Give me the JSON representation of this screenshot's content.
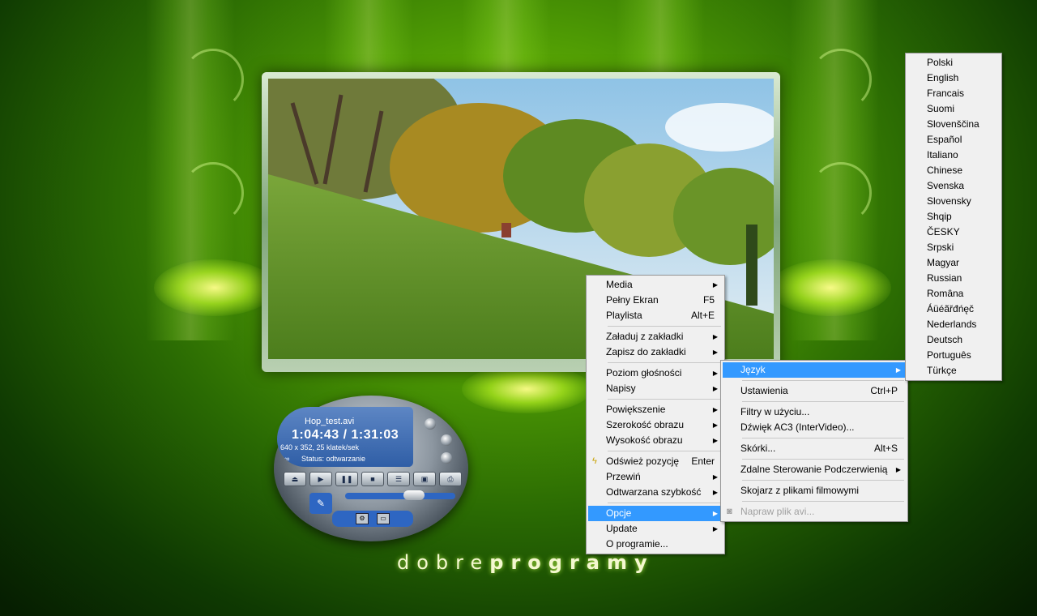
{
  "player": {
    "filename": "Hop_test.avi",
    "time": "1:04:43 / 1:31:03",
    "resolution": "640 x 352, 25 klatek/sek",
    "status": "Status: odtwarzanie"
  },
  "logo": {
    "light": "dobre",
    "bold": "programy"
  },
  "main_menu": {
    "items": [
      {
        "label": "Media",
        "shortcut": "",
        "submenu": true
      },
      {
        "label": "Pełny Ekran",
        "shortcut": "F5",
        "submenu": false
      },
      {
        "label": "Playlista",
        "shortcut": "Alt+E",
        "submenu": false
      },
      {
        "label": "Załaduj z zakładki",
        "shortcut": "",
        "submenu": true
      },
      {
        "label": "Zapisz do zakładki",
        "shortcut": "",
        "submenu": true
      },
      {
        "label": "Poziom głośności",
        "shortcut": "",
        "submenu": true
      },
      {
        "label": "Napisy",
        "shortcut": "",
        "submenu": true
      },
      {
        "label": "Powiększenie",
        "shortcut": "",
        "submenu": true
      },
      {
        "label": "Szerokość obrazu",
        "shortcut": "",
        "submenu": true
      },
      {
        "label": "Wysokość obrazu",
        "shortcut": "",
        "submenu": true
      },
      {
        "label": "Odśwież pozycję",
        "shortcut": "Enter",
        "submenu": false
      },
      {
        "label": "Przewiń",
        "shortcut": "",
        "submenu": true
      },
      {
        "label": "Odtwarzana szybkość",
        "shortcut": "",
        "submenu": true
      },
      {
        "label": "Opcje",
        "shortcut": "",
        "submenu": true
      },
      {
        "label": "Update",
        "shortcut": "",
        "submenu": true
      },
      {
        "label": "O programie...",
        "shortcut": "",
        "submenu": false
      }
    ]
  },
  "options_menu": {
    "items": [
      {
        "label": "Język",
        "shortcut": ""
      },
      {
        "label": "Ustawienia",
        "shortcut": "Ctrl+P"
      },
      {
        "label": "Filtry w użyciu...",
        "shortcut": ""
      },
      {
        "label": "Dźwięk AC3 (InterVideo)...",
        "shortcut": ""
      },
      {
        "label": "Skórki...",
        "shortcut": "Alt+S"
      },
      {
        "label": "Zdalne Sterowanie Podczerwienią",
        "shortcut": ""
      },
      {
        "label": "Skojarz z plikami filmowymi",
        "shortcut": ""
      },
      {
        "label": "Napraw plik avi...",
        "shortcut": ""
      }
    ]
  },
  "languages": [
    "Polski",
    "English",
    "Francais",
    "Suomi",
    "Slovenščina",
    "Español",
    "Italiano",
    "Chinese",
    "Svenska",
    "Slovensky",
    "Shqip",
    "ČESKY",
    "Srpski",
    "Magyar",
    "Russian",
    "Româna",
    "Áüéãřđńęč",
    "Nederlands",
    "Deutsch",
    "Português",
    "Türkçe"
  ],
  "colors": {
    "menu_highlight": "#3399ff",
    "menu_bg": "#f0f0f0",
    "player_lcd": "#3a6ab3"
  }
}
